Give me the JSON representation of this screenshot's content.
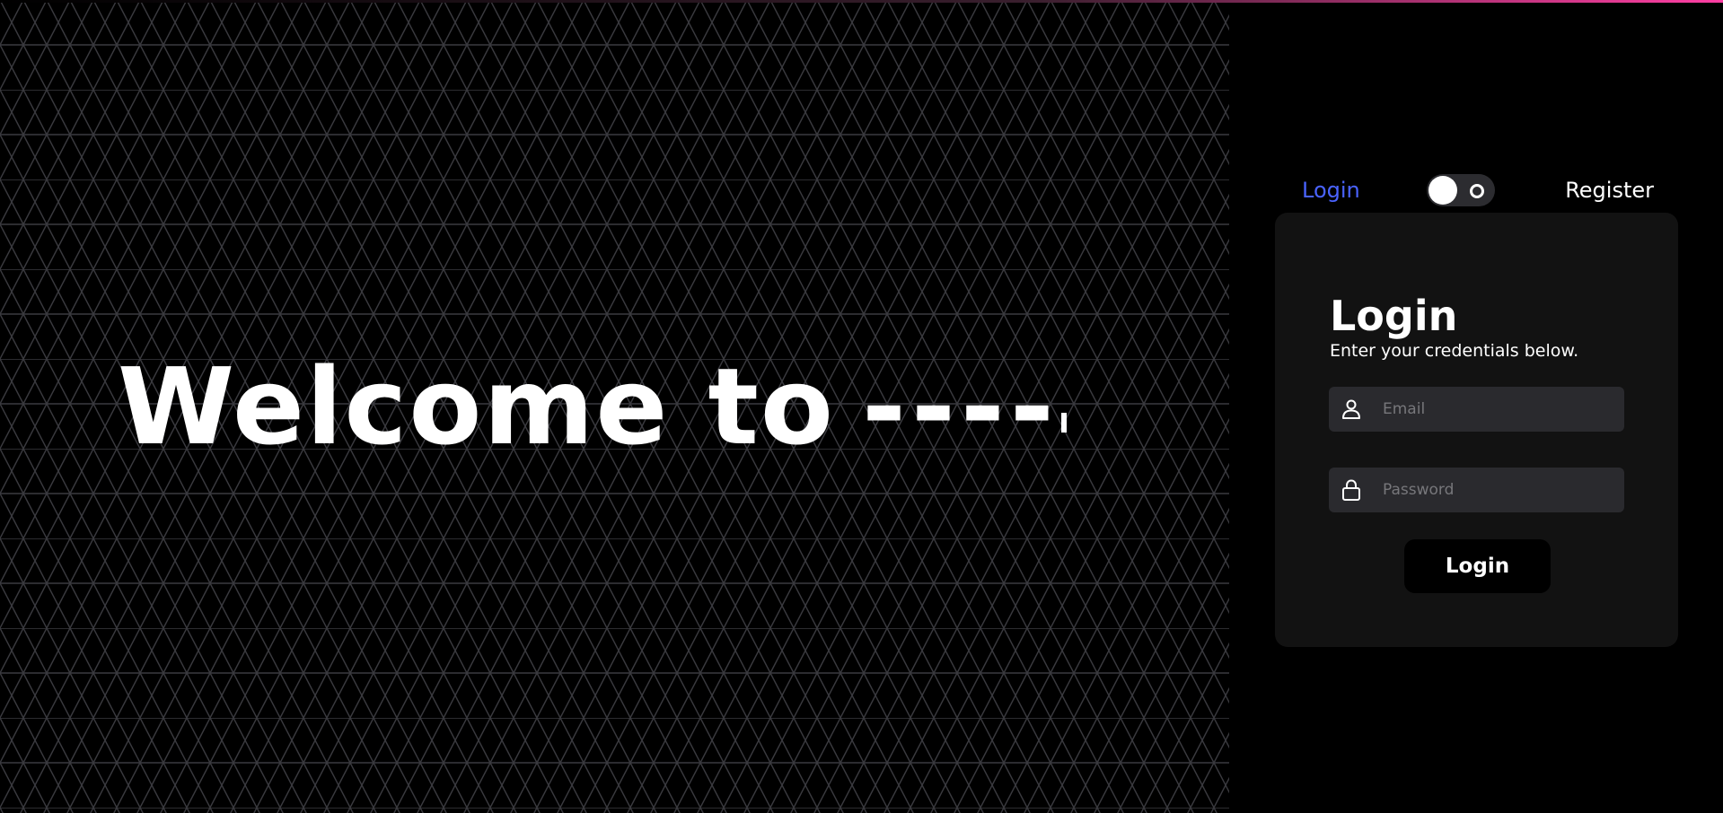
{
  "hero": {
    "title_text": "Welcome to",
    "title_dashes": "----"
  },
  "switcher": {
    "login_label": "Login",
    "register_label": "Register",
    "toggle_state": "login"
  },
  "login_card": {
    "title": "Login",
    "subtitle": "Enter your credentials below.",
    "email": {
      "placeholder": "Email",
      "value": ""
    },
    "password": {
      "placeholder": "Password",
      "value": ""
    },
    "submit_label": "Login"
  },
  "colors": {
    "accent_blue": "#4a63ff",
    "background": "#000000",
    "card": "#121212",
    "field": "#2a2a2e",
    "pattern_line": "#3a3a3f",
    "top_accent": "#ff3fa4"
  },
  "icons": {
    "email_icon": "user-icon",
    "password_icon": "lock-icon",
    "toggle_icon": "circle-icon"
  }
}
